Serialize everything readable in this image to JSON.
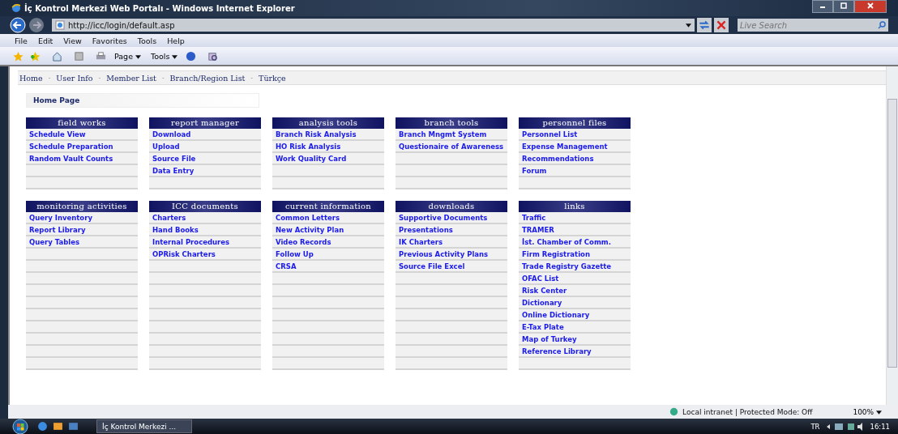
{
  "window": {
    "title": "İç Kontrol Merkezi Web Portalı - Windows Internet Explorer"
  },
  "address_bar": {
    "url": "http://icc/login/default.asp"
  },
  "search": {
    "placeholder": "Live Search"
  },
  "menu": [
    "File",
    "Edit",
    "View",
    "Favorites",
    "Tools",
    "Help"
  ],
  "command_bar": [
    "Page",
    "Tools"
  ],
  "nav": {
    "separator": "-",
    "items": [
      "Home",
      "User Info",
      "Member List",
      "Branch/Region List",
      "Türkçe"
    ]
  },
  "breadcrumb": "Home Page",
  "panel_groups": [
    {
      "panels": [
        {
          "title": "field works",
          "items": [
            "Schedule View",
            "Schedule Preparation",
            "Random Vault Counts"
          ]
        },
        {
          "title": "report manager",
          "items": [
            "Download",
            "Upload",
            "Source File",
            "Data Entry"
          ]
        },
        {
          "title": "analysis tools",
          "items": [
            "Branch Risk Analysis",
            "HO Risk Analysis",
            "Work Quality Card"
          ]
        },
        {
          "title": "branch tools",
          "items": [
            "Branch Mngmt System",
            "Questionaire of Awareness"
          ]
        },
        {
          "title": "personnel files",
          "items": [
            "Personnel List",
            "Expense Management",
            "Recommendations",
            "Forum"
          ]
        }
      ]
    },
    {
      "panels": [
        {
          "title": "monitoring activities",
          "items": [
            "Query Inventory",
            "Report Library",
            "Query Tables"
          ]
        },
        {
          "title": "ICC documents",
          "items": [
            "Charters",
            "Hand Books",
            "Internal Procedures",
            "OPRisk Charters"
          ]
        },
        {
          "title": "current information",
          "items": [
            "Common Letters",
            "New Activity Plan",
            "Video Records",
            "Follow Up",
            "CRSA"
          ]
        },
        {
          "title": "downloads",
          "items": [
            "Supportive Documents",
            "Presentations",
            "IK Charters",
            "Previous Activity Plans",
            "Source File Excel"
          ]
        },
        {
          "title": "links",
          "items": [
            "Traffic",
            "TRAMER",
            "İst. Chamber of Comm.",
            "Firm Registration",
            "Trade Registry Gazette",
            "OFAC List",
            "Risk Center",
            "Dictionary",
            "Online Dictionary",
            "E-Tax Plate",
            "Map of Turkey",
            "Reference Library"
          ]
        }
      ]
    }
  ],
  "status_bar": {
    "zone": "Local intranet | Protected Mode: Off",
    "zoom": "100%"
  },
  "taskbar": {
    "task": "İç Kontrol Merkezi ...",
    "language": "TR",
    "time": "16:11"
  }
}
